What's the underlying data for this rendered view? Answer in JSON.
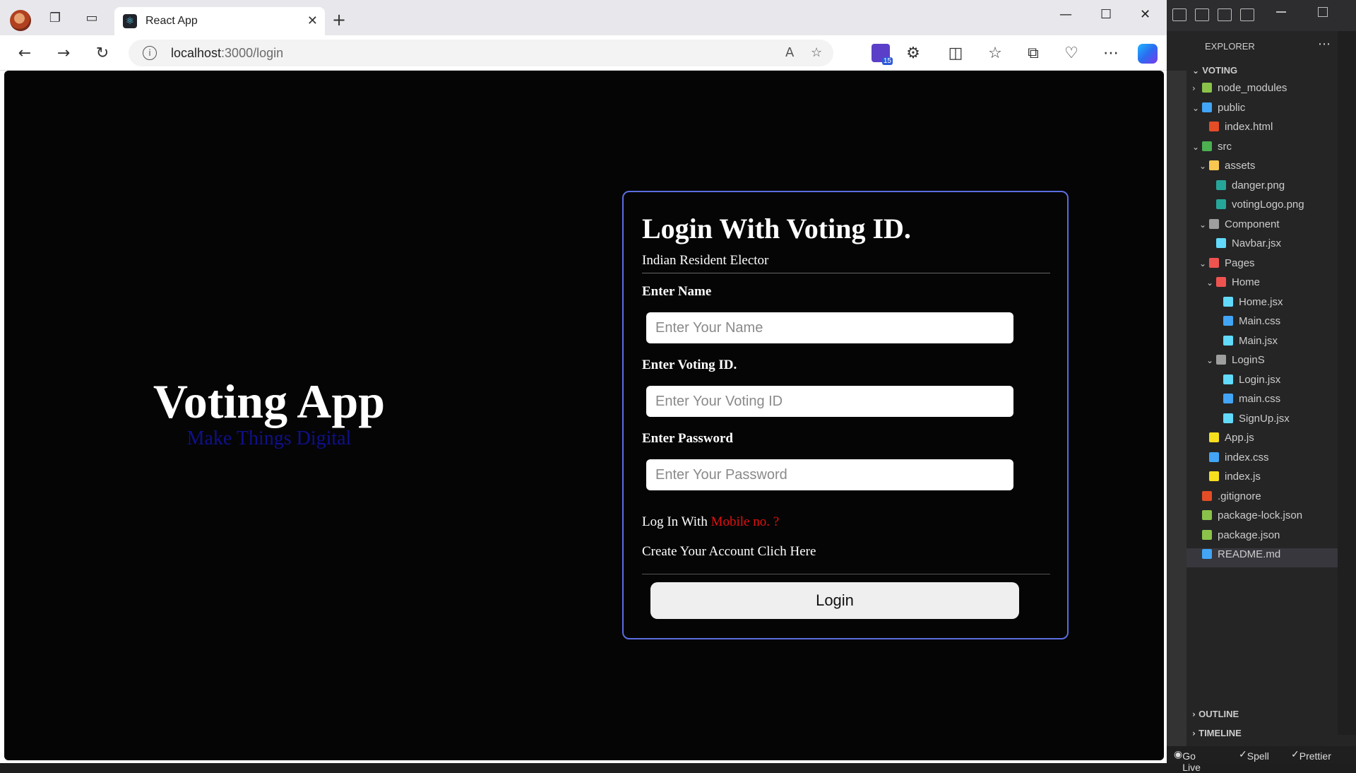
{
  "browser": {
    "tab_title": "React App",
    "url_host": "localhost",
    "url_path": ":3000/login",
    "badge_count": "15"
  },
  "app": {
    "brand_title": "Voting App",
    "brand_subtitle": "Make Things Digital",
    "form": {
      "heading": "Login With Voting ID.",
      "subheading": "Indian Resident Elector",
      "name_label": "Enter Name",
      "name_placeholder": "Enter Your Name",
      "voting_label": "Enter Voting ID.",
      "voting_placeholder": "Enter Your Voting ID",
      "password_label": "Enter Password",
      "password_placeholder": "Enter Your Password",
      "mobile_prefix": "Log In With",
      "mobile_link": "Mobile no. ?",
      "create_account": "Create Your Account Clich Here",
      "login_button": "Login"
    }
  },
  "vscode": {
    "explorer_title": "EXPLORER",
    "root": "VOTING",
    "items": [
      {
        "label": "node_modules",
        "color": "#8bc34a"
      },
      {
        "label": "public",
        "color": "#42a5f5"
      },
      {
        "label": "index.html",
        "color": "#e44d26"
      },
      {
        "label": "src",
        "color": "#4caf50"
      },
      {
        "label": "assets",
        "color": "#f9c74f"
      },
      {
        "label": "danger.png",
        "color": "#26a69a"
      },
      {
        "label": "votingLogo.png",
        "color": "#26a69a"
      },
      {
        "label": "Component",
        "color": "#9e9e9e"
      },
      {
        "label": "Navbar.jsx",
        "color": "#61dafb"
      },
      {
        "label": "Pages",
        "color": "#ef5350"
      },
      {
        "label": "Home",
        "color": "#ef5350"
      },
      {
        "label": "Home.jsx",
        "color": "#61dafb"
      },
      {
        "label": "Main.css",
        "color": "#42a5f5"
      },
      {
        "label": "Main.jsx",
        "color": "#61dafb"
      },
      {
        "label": "LoginS",
        "color": "#9e9e9e"
      },
      {
        "label": "Login.jsx",
        "color": "#61dafb"
      },
      {
        "label": "main.css",
        "color": "#42a5f5"
      },
      {
        "label": "SignUp.jsx",
        "color": "#61dafb"
      },
      {
        "label": "App.js",
        "color": "#f7df1e"
      },
      {
        "label": "index.css",
        "color": "#42a5f5"
      },
      {
        "label": "index.js",
        "color": "#f7df1e"
      },
      {
        "label": ".gitignore",
        "color": "#e44d26"
      },
      {
        "label": "package-lock.json",
        "color": "#8bc34a"
      },
      {
        "label": "package.json",
        "color": "#8bc34a"
      },
      {
        "label": "README.md",
        "color": "#42a5f5"
      }
    ],
    "outline": "OUTLINE",
    "timeline": "TIMELINE",
    "status": {
      "golive": "Go Live",
      "spell": "Spell",
      "prettier": "Prettier"
    }
  }
}
